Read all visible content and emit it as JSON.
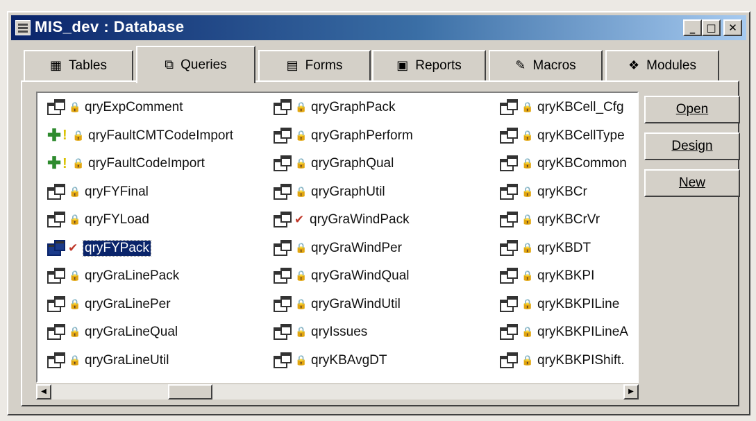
{
  "window": {
    "title": "MIS_dev : Database",
    "icon": "database-window-icon",
    "controls": [
      {
        "name": "minimize",
        "glyph": "_"
      },
      {
        "name": "maximize",
        "glyph": "□"
      },
      {
        "name": "close",
        "glyph": "✕"
      }
    ]
  },
  "tabs": [
    {
      "label": "Tables",
      "icon": "table-icon",
      "glyph": "▦",
      "active": false
    },
    {
      "label": "Queries",
      "icon": "query-icon",
      "glyph": "⧉",
      "active": true
    },
    {
      "label": "Forms",
      "icon": "form-icon",
      "glyph": "▤",
      "active": false
    },
    {
      "label": "Reports",
      "icon": "report-icon",
      "glyph": "▣",
      "active": false
    },
    {
      "label": "Macros",
      "icon": "macro-icon",
      "glyph": "✎",
      "active": false
    },
    {
      "label": "Modules",
      "icon": "module-icon",
      "glyph": "❖",
      "active": false
    }
  ],
  "queries": {
    "columns": [
      [
        {
          "name": "qryExpComment",
          "badge": "lock"
        },
        {
          "name": "qryFaultCMTCodeImport",
          "badge": "append"
        },
        {
          "name": "qryFaultCodeImport",
          "badge": "append"
        },
        {
          "name": "qryFYFinal",
          "badge": "lock"
        },
        {
          "name": "qryFYLoad",
          "badge": "lock"
        },
        {
          "name": "qryFYPack",
          "badge": "check",
          "selected": true
        },
        {
          "name": "qryGraLinePack",
          "badge": "lock"
        },
        {
          "name": "qryGraLinePer",
          "badge": "lock"
        },
        {
          "name": "qryGraLineQual",
          "badge": "lock"
        },
        {
          "name": "qryGraLineUtil",
          "badge": "lock"
        }
      ],
      [
        {
          "name": "qryGraphPack",
          "badge": "lock"
        },
        {
          "name": "qryGraphPerform",
          "badge": "lock"
        },
        {
          "name": "qryGraphQual",
          "badge": "lock"
        },
        {
          "name": "qryGraphUtil",
          "badge": "lock"
        },
        {
          "name": "qryGraWindPack",
          "badge": "check"
        },
        {
          "name": "qryGraWindPer",
          "badge": "lock"
        },
        {
          "name": "qryGraWindQual",
          "badge": "lock"
        },
        {
          "name": "qryGraWindUtil",
          "badge": "lock"
        },
        {
          "name": "qryIssues",
          "badge": "lock"
        },
        {
          "name": "qryKBAvgDT",
          "badge": "lock"
        }
      ],
      [
        {
          "name": "qryKBCell_Cfg",
          "badge": "lock"
        },
        {
          "name": "qryKBCellType",
          "badge": "lock"
        },
        {
          "name": "qryKBCommon",
          "badge": "lock"
        },
        {
          "name": "qryKBCr",
          "badge": "lock"
        },
        {
          "name": "qryKBCrVr",
          "badge": "lock"
        },
        {
          "name": "qryKBDT",
          "badge": "lock"
        },
        {
          "name": "qryKBKPI",
          "badge": "lock"
        },
        {
          "name": "qryKBKPILine",
          "badge": "lock"
        },
        {
          "name": "qryKBKPILineA",
          "badge": "lock"
        },
        {
          "name": "qryKBKPIShift.",
          "badge": "lock"
        }
      ]
    ]
  },
  "buttons": {
    "open": "Open",
    "design": "Design",
    "new": "New"
  },
  "scrollbar": {
    "left_arrow": "◀",
    "right_arrow": "▶"
  }
}
